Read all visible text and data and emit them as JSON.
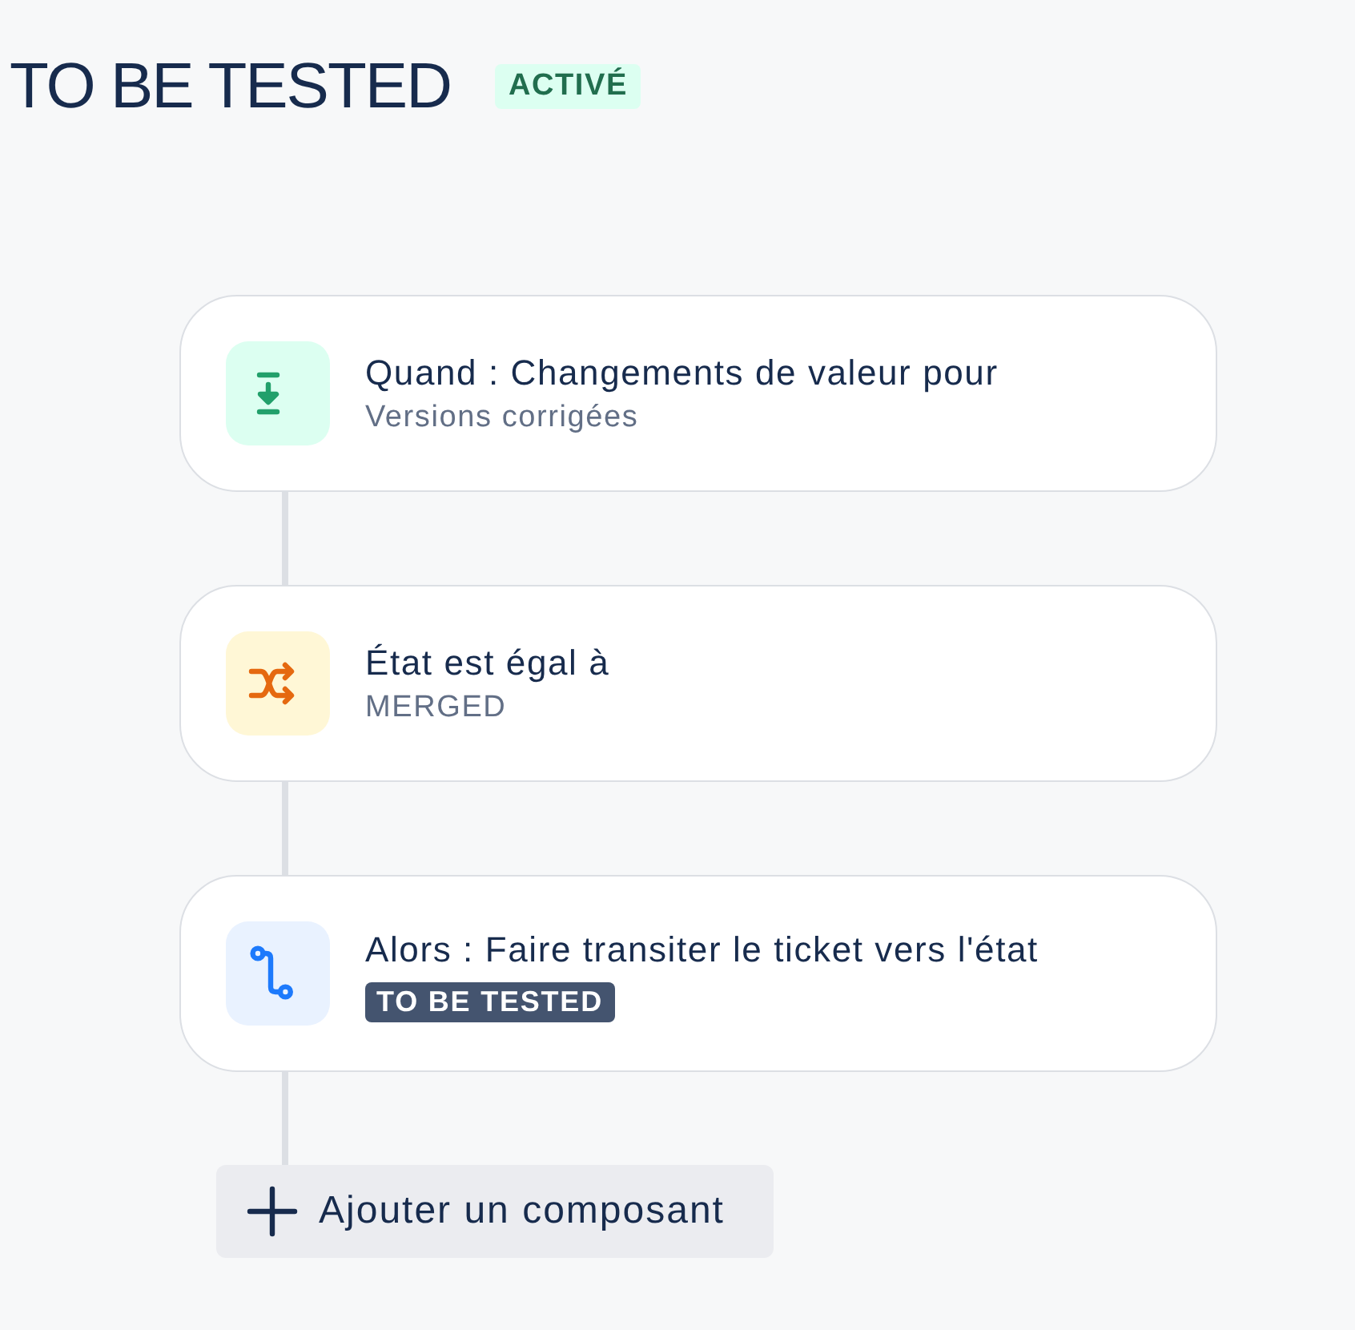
{
  "header": {
    "title": "TO BE TESTED",
    "status": {
      "label": "ACTIVÉ",
      "kind": "success"
    }
  },
  "components": [
    {
      "kind": "trigger",
      "title": "Quand : Changements de valeur pour",
      "detail": {
        "kind": "text",
        "text": "Versions corrigées"
      }
    },
    {
      "kind": "condition",
      "title": "État est égal à",
      "detail": {
        "kind": "text",
        "text": "MERGED"
      }
    },
    {
      "kind": "action",
      "title": "Alors : Faire transiter le ticket vers l'état",
      "detail": {
        "kind": "lozenge",
        "text": "TO BE TESTED"
      }
    }
  ],
  "add_button": {
    "label": "Ajouter un composant"
  }
}
